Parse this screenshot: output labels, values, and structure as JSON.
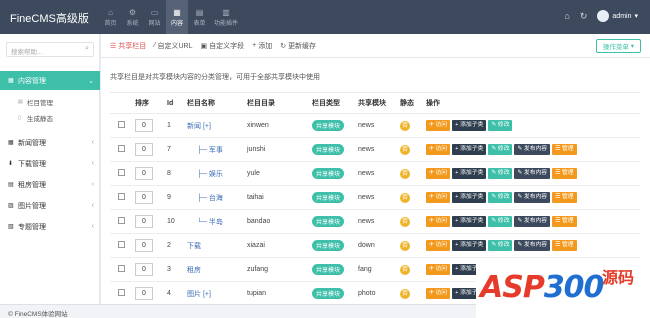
{
  "app": {
    "title": "FineCMS高级版"
  },
  "topnav": [
    {
      "label": "首页",
      "icon": "home-icon",
      "glyph": "⌂"
    },
    {
      "label": "系统",
      "icon": "gear-icon",
      "glyph": "⚙"
    },
    {
      "label": "网站",
      "icon": "monitor-icon",
      "glyph": "▭"
    },
    {
      "label": "内容",
      "icon": "grid-icon",
      "glyph": "▦",
      "active": true
    },
    {
      "label": "表单",
      "icon": "table-icon",
      "glyph": "▤"
    },
    {
      "label": "功能插件",
      "icon": "plugin-icon",
      "glyph": "▥"
    }
  ],
  "topright": {
    "user": "admin"
  },
  "sidebar": {
    "search_placeholder": "搜索帮助...",
    "sections": [
      {
        "label": "内容管理",
        "active": true
      },
      {
        "label": "新闻管理"
      },
      {
        "label": "下载管理"
      },
      {
        "label": "租房管理"
      },
      {
        "label": "图片管理"
      },
      {
        "label": "专题管理"
      }
    ],
    "subitems": [
      "栏目管理",
      "生成静态"
    ]
  },
  "tabs": [
    "共享栏目",
    "自定义URL",
    "自定义字段",
    "添加",
    "更新缓存"
  ],
  "op_menu": "操作菜单",
  "note": "共享栏目是对共享模块内容的分类管理，可用于全部共享模块中使用",
  "table": {
    "headers": [
      "排序",
      "Id",
      "栏目名称",
      "栏目目录",
      "栏目类型",
      "共享模块",
      "静态",
      "操作"
    ],
    "rows": [
      {
        "sort": "0",
        "id": "1",
        "name": "新闻 [+]",
        "dir": "xinwen",
        "type": "共享模块",
        "module": "news",
        "static": "否",
        "buttons": [
          "访问",
          "添加子类",
          "修改"
        ]
      },
      {
        "sort": "0",
        "id": "7",
        "name": "├─ 军事",
        "dir": "junshi",
        "type": "共享模块",
        "module": "news",
        "static": "否",
        "buttons": [
          "访问",
          "添加子类",
          "修改",
          "发布内容",
          "管理"
        ]
      },
      {
        "sort": "0",
        "id": "8",
        "name": "├─ 娱乐",
        "dir": "yule",
        "type": "共享模块",
        "module": "news",
        "static": "否",
        "buttons": [
          "访问",
          "添加子类",
          "修改",
          "发布内容",
          "管理"
        ]
      },
      {
        "sort": "0",
        "id": "9",
        "name": "├─ 台海",
        "dir": "taihai",
        "type": "共享模块",
        "module": "news",
        "static": "否",
        "buttons": [
          "访问",
          "添加子类",
          "修改",
          "发布内容",
          "管理"
        ]
      },
      {
        "sort": "0",
        "id": "10",
        "name": "└─ 半岛",
        "dir": "bandao",
        "type": "共享模块",
        "module": "news",
        "static": "否",
        "buttons": [
          "访问",
          "添加子类",
          "修改",
          "发布内容",
          "管理"
        ]
      },
      {
        "sort": "0",
        "id": "2",
        "name": "下载",
        "dir": "xiazai",
        "type": "共享模块",
        "module": "down",
        "static": "否",
        "buttons": [
          "访问",
          "添加子类",
          "修改",
          "发布内容",
          "管理"
        ]
      },
      {
        "sort": "0",
        "id": "3",
        "name": "租房",
        "dir": "zufang",
        "type": "共享模块",
        "module": "fang",
        "static": "否",
        "buttons": [
          "访问",
          "添加子类",
          "修改",
          "发布内容",
          "管理"
        ]
      },
      {
        "sort": "0",
        "id": "4",
        "name": "图片 [+]",
        "dir": "tupian",
        "type": "共享模块",
        "module": "photo",
        "static": "否",
        "buttons": [
          "访问",
          "添加子类",
          "修改"
        ]
      }
    ]
  },
  "footer": "© FineCMS体验网站",
  "watermark": {
    "text_red": "ASP",
    "text_blue": "300",
    "cn": "源码"
  },
  "colors": {
    "topbar": "#3d4a5d",
    "accent": "#3dbfaa",
    "orange": "#f39a1e",
    "tab_active": "#d9534f"
  }
}
